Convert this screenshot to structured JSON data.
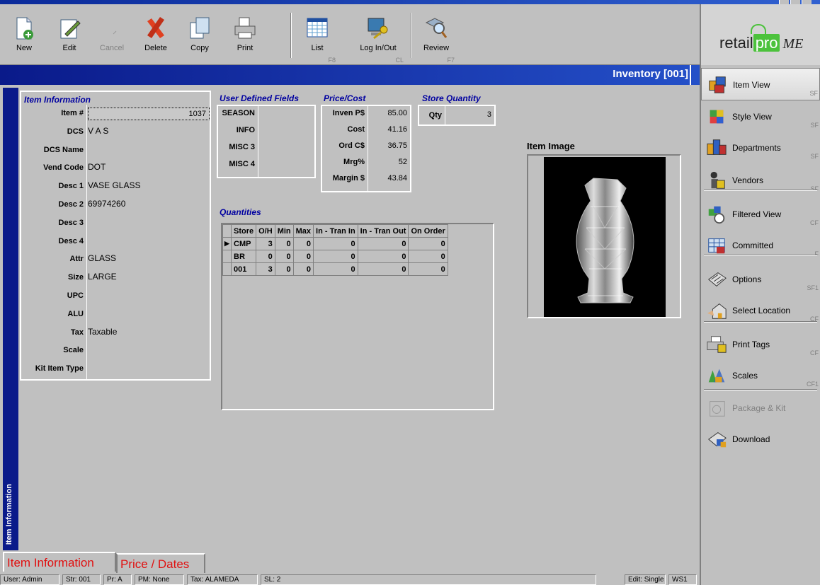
{
  "window": {
    "title": "Inventory [001]"
  },
  "toolbar": {
    "buttons": [
      {
        "label": "New",
        "key": ""
      },
      {
        "label": "Edit",
        "key": ""
      },
      {
        "label": "Cancel",
        "key": ""
      },
      {
        "label": "Delete",
        "key": ""
      },
      {
        "label": "Copy",
        "key": ""
      },
      {
        "label": "Print",
        "key": ""
      },
      {
        "label": "List",
        "key": "F8"
      },
      {
        "label": "Log In/Out",
        "key": "CL"
      },
      {
        "label": "Review",
        "key": "F7"
      }
    ]
  },
  "logo": {
    "word": "retail",
    "pro": "pro",
    "me": "ME"
  },
  "item_info": {
    "title": "Item Information",
    "fields": [
      {
        "label": "Item #",
        "value": "1037"
      },
      {
        "label": "DCS",
        "value": "V A S"
      },
      {
        "label": "DCS Name",
        "value": ""
      },
      {
        "label": "Vend Code",
        "value": "DOT"
      },
      {
        "label": "Desc 1",
        "value": "VASE GLASS"
      },
      {
        "label": "Desc 2",
        "value": "69974260"
      },
      {
        "label": "Desc 3",
        "value": ""
      },
      {
        "label": "Desc 4",
        "value": ""
      },
      {
        "label": "Attr",
        "value": "GLASS"
      },
      {
        "label": "Size",
        "value": "LARGE"
      },
      {
        "label": "UPC",
        "value": ""
      },
      {
        "label": "ALU",
        "value": ""
      },
      {
        "label": "Tax",
        "value": "Taxable"
      },
      {
        "label": "Scale",
        "value": ""
      },
      {
        "label": "Kit Item Type",
        "value": ""
      }
    ]
  },
  "udf": {
    "title": "User Defined Fields",
    "fields": [
      {
        "label": "SEASON",
        "value": ""
      },
      {
        "label": "INFO",
        "value": ""
      },
      {
        "label": "MISC 3",
        "value": ""
      },
      {
        "label": "MISC 4",
        "value": ""
      }
    ]
  },
  "price_cost": {
    "title": "Price/Cost",
    "fields": [
      {
        "label": "Inven P$",
        "value": "85.00"
      },
      {
        "label": "Cost",
        "value": "41.16"
      },
      {
        "label": "Ord C$",
        "value": "36.75"
      },
      {
        "label": "Mrg%",
        "value": "52"
      },
      {
        "label": "Margin $",
        "value": "43.84"
      }
    ]
  },
  "store_qty": {
    "title": "Store Quantity",
    "label": "Qty",
    "value": "3"
  },
  "quantities": {
    "title": "Quantities",
    "columns": [
      "Store",
      "O/H",
      "Min",
      "Max",
      "In - Tran In",
      "In - Tran Out",
      "On Order"
    ],
    "rows": [
      [
        "CMP",
        "3",
        "0",
        "0",
        "0",
        "0",
        "0"
      ],
      [
        "BR",
        "0",
        "0",
        "0",
        "0",
        "0",
        "0"
      ],
      [
        "001",
        "3",
        "0",
        "0",
        "0",
        "0",
        "0"
      ]
    ]
  },
  "item_image": {
    "title": "Item Image"
  },
  "vertical_tab": {
    "label": "Item Information"
  },
  "bottom_tabs": [
    {
      "label": "Item Information",
      "active": true
    },
    {
      "label": "Price / Dates",
      "active": false
    }
  ],
  "status": {
    "user": "User: Admin",
    "store": "Str: 001",
    "price": "Pr: A",
    "pm": "PM: None",
    "tax": "Tax: ALAMEDA",
    "sl": "SL: 2",
    "edit": "Edit: Single",
    "ws": "WS1"
  },
  "sidebar": {
    "items": [
      {
        "label": "Item View",
        "key": "SF"
      },
      {
        "label": "Style View",
        "key": "SF"
      },
      {
        "label": "Departments",
        "key": "SF"
      },
      {
        "label": "Vendors",
        "key": "SF"
      },
      {
        "label": "Filtered View",
        "key": "CF"
      },
      {
        "label": "Committed",
        "key": "F"
      },
      {
        "label": "Options",
        "key": "SF1"
      },
      {
        "label": "Select Location",
        "key": "CF"
      },
      {
        "label": "Print Tags",
        "key": "CF"
      },
      {
        "label": "Scales",
        "key": "CF1"
      },
      {
        "label": "Package & Kit",
        "key": ""
      },
      {
        "label": "Download",
        "key": ""
      }
    ]
  }
}
